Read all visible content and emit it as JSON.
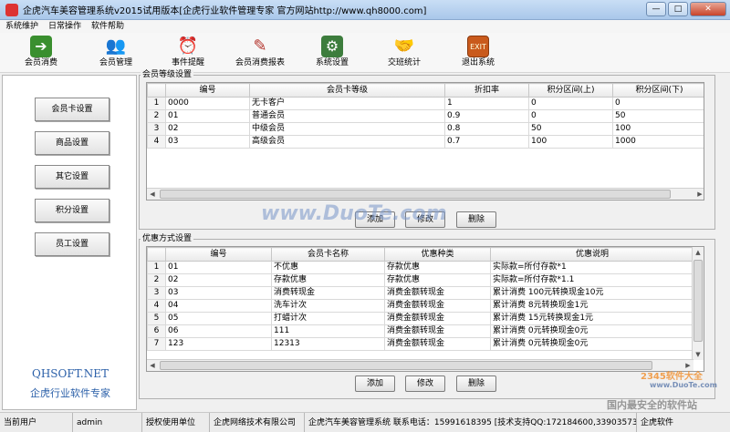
{
  "window": {
    "title": "企虎汽车美容管理系统v2015试用版本[企虎行业软件管理专家 官方网站http://www.qh8000.com]",
    "minimize": "—",
    "maximize": "□",
    "close": "✕"
  },
  "menu": [
    "系统维护",
    "日常操作",
    "软件帮助"
  ],
  "toolbar": [
    {
      "label": "会员消费",
      "icon": "arrow-consume-icon",
      "color": "#3a8f2f"
    },
    {
      "label": "会员管理",
      "icon": "users-icon",
      "color": "#c0762a"
    },
    {
      "label": "事件提醒",
      "icon": "alarm-clock-icon",
      "color": "#444444"
    },
    {
      "label": "会员消费报表",
      "icon": "report-pen-icon",
      "color": "#b3332b"
    },
    {
      "label": "系统设置",
      "icon": "settings-book-icon",
      "color": "#3d7d3d"
    },
    {
      "label": "交班统计",
      "icon": "handshake-icon",
      "color": "#6a5a3a"
    },
    {
      "label": "退出系统",
      "icon": "exit-door-icon",
      "color": "#c95a1c"
    }
  ],
  "sidebar": {
    "buttons": [
      "会员卡设置",
      "商品设置",
      "其它设置",
      "积分设置",
      "员工设置"
    ],
    "brand_line1": "QHSOFT.NET",
    "brand_line2": "企虎行业软件专家"
  },
  "member_levels": {
    "title": "会员等级设置",
    "columns": [
      "编号",
      "会员卡等级",
      "折扣率",
      "积分区间(上)",
      "积分区间(下)"
    ],
    "rows": [
      {
        "n": "1",
        "id": "0000",
        "level": "无卡客户",
        "discount": "1",
        "upper": "0",
        "lower": "0"
      },
      {
        "n": "2",
        "id": "01",
        "level": "普通会员",
        "discount": "0.9",
        "upper": "0",
        "lower": "50"
      },
      {
        "n": "3",
        "id": "02",
        "level": "中级会员",
        "discount": "0.8",
        "upper": "50",
        "lower": "100"
      },
      {
        "n": "4",
        "id": "03",
        "level": "高级会员",
        "discount": "0.7",
        "upper": "100",
        "lower": "1000"
      }
    ],
    "buttons": {
      "add": "添加",
      "edit": "修改",
      "delete": "删除"
    }
  },
  "discounts": {
    "title": "优惠方式设置",
    "columns": [
      "编号",
      "会员卡名称",
      "优惠种类",
      "优惠说明"
    ],
    "rows": [
      {
        "n": "1",
        "id": "01",
        "name": "不优惠",
        "type": "存款优惠",
        "desc": "实际款=所付存款*1"
      },
      {
        "n": "2",
        "id": "02",
        "name": "存款优惠",
        "type": "存款优惠",
        "desc": "实际款=所付存款*1.1"
      },
      {
        "n": "3",
        "id": "03",
        "name": "消费转现金",
        "type": "消费金额转现金",
        "desc": "累计消费 100元转换现金10元"
      },
      {
        "n": "4",
        "id": "04",
        "name": "洗车计次",
        "type": "消费金额转现金",
        "desc": "累计消费 8元转换现金1元"
      },
      {
        "n": "5",
        "id": "05",
        "name": "打蜡计次",
        "type": "消费金额转现金",
        "desc": "累计消费 15元转换现金1元"
      },
      {
        "n": "6",
        "id": "06",
        "name": "111",
        "type": "消费金额转现金",
        "desc": "累计消费 0元转换现金0元"
      },
      {
        "n": "7",
        "id": "123",
        "name": "12313",
        "type": "消费金额转现金",
        "desc": "累计消费 0元转换现金0元"
      }
    ],
    "buttons": {
      "add": "添加",
      "edit": "修改",
      "delete": "删除"
    }
  },
  "status": {
    "user_label": "当前用户",
    "user": "admin",
    "license_label": "授权使用单位",
    "company": "企虎网络技术有限公司",
    "contact": "企虎汽车美容管理系统 联系电话：15991618395 [技术支持QQ:172184600,33903573]",
    "vendor": "企虎软件"
  },
  "watermarks": {
    "center": "www.DuoTe.com",
    "corner1": "2345软件大全",
    "corner2": "国内最安全的软件站",
    "corner_url": "www.DuoTe.com"
  }
}
